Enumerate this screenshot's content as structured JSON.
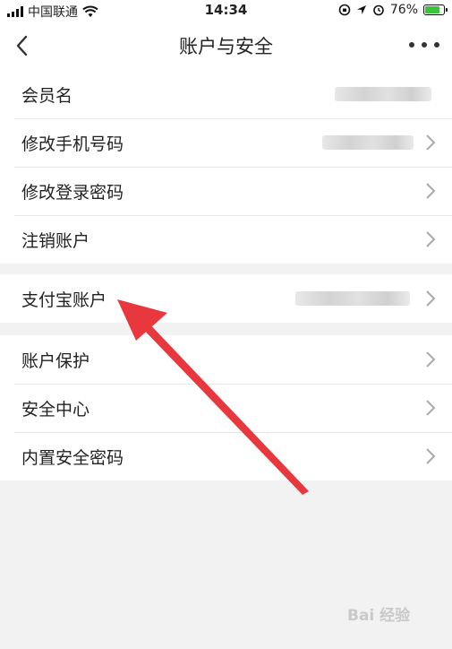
{
  "status_bar": {
    "carrier": "中国联通",
    "time": "14:34",
    "battery": "76%"
  },
  "nav": {
    "title": "账户与安全"
  },
  "groups": [
    {
      "items": [
        {
          "label": "会员名"
        },
        {
          "label": "修改手机号码"
        },
        {
          "label": "修改登录密码"
        },
        {
          "label": "注销账户"
        }
      ]
    },
    {
      "items": [
        {
          "label": "支付宝账户"
        }
      ]
    },
    {
      "items": [
        {
          "label": "账户保护"
        },
        {
          "label": "安全中心"
        },
        {
          "label": "内置安全密码"
        }
      ]
    }
  ],
  "annotation": {
    "arrow_color": "#e8383d"
  },
  "watermark": "Bai 经验"
}
